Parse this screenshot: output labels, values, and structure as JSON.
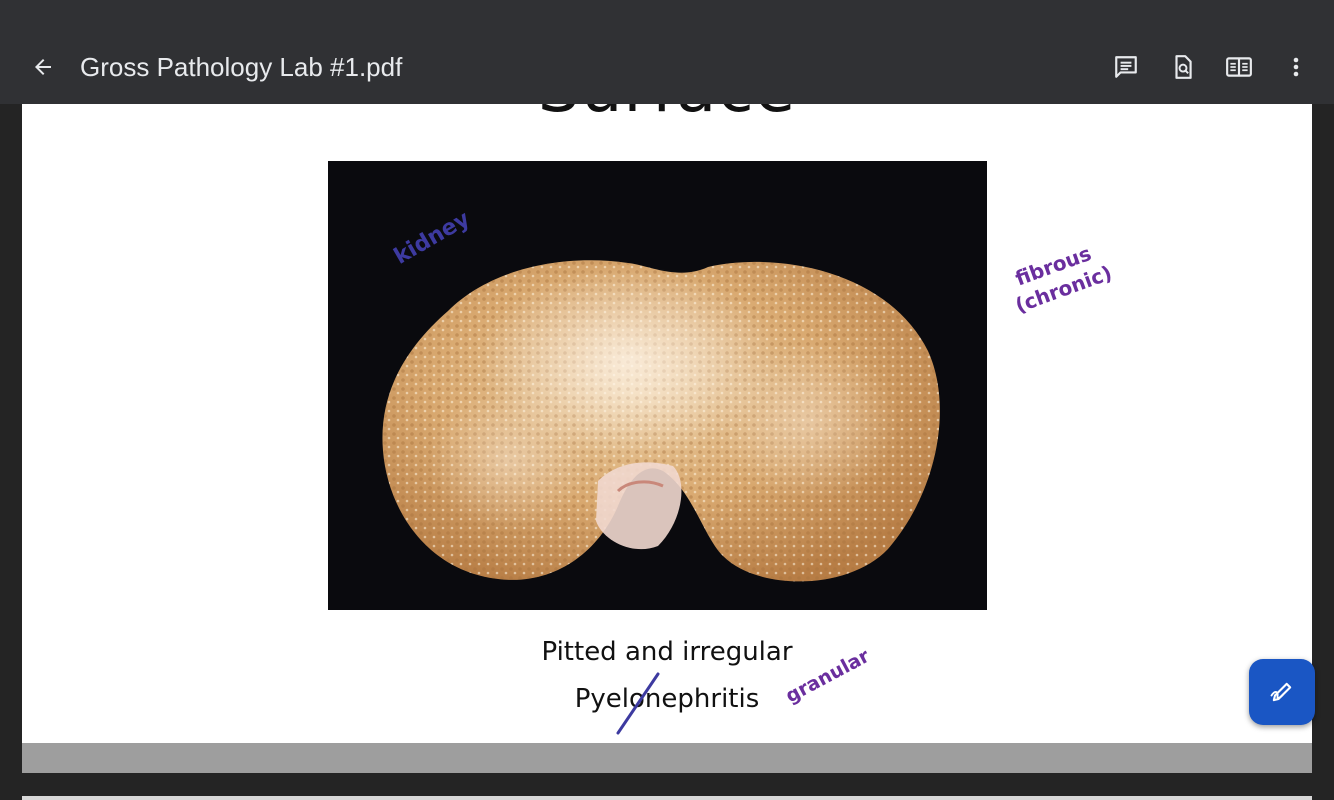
{
  "header": {
    "title": "Gross Pathology Lab #1.pdf",
    "back_icon": "arrow-back-icon",
    "actions": [
      {
        "name": "comment-icon"
      },
      {
        "name": "find-in-page-icon"
      },
      {
        "name": "reading-mode-icon"
      },
      {
        "name": "more-options-icon"
      }
    ]
  },
  "slide": {
    "title": "Surface",
    "caption_line1": "Pitted and irregular",
    "caption_line2": "Pyelonephritis"
  },
  "annotations": {
    "kidney": "kidney",
    "fibrous": "fibrous",
    "chronic": "(chronic)",
    "granular": "granular",
    "ink_blue": "#3d3aa0",
    "ink_purple": "#6a2e9e"
  },
  "fab": {
    "icon": "edit-pen-icon"
  },
  "colors": {
    "topbar": "#303134",
    "background": "#242424",
    "fab": "#1a56c4"
  }
}
